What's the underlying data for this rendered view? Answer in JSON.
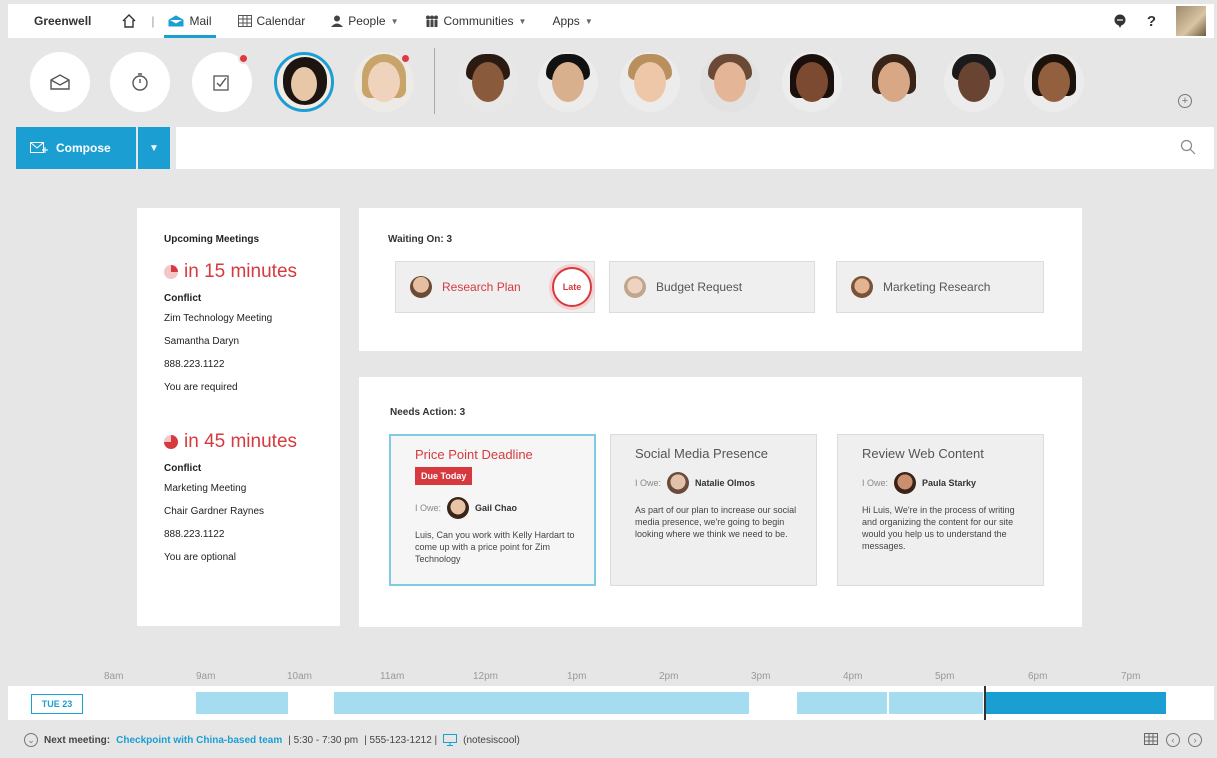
{
  "app": {
    "brand": "Greenwell"
  },
  "nav": {
    "mail": "Mail",
    "calendar": "Calendar",
    "people": "People",
    "communities": "Communities",
    "apps": "Apps"
  },
  "compose": {
    "label": "Compose"
  },
  "meetings": {
    "title": "Upcoming Meetings",
    "items": [
      {
        "when": "in 15 minutes",
        "conflict": "Conflict",
        "name": "Zim Technology Meeting",
        "chair": "Samantha Daryn",
        "phone": "888.223.1122",
        "req": "You are required"
      },
      {
        "when": "in 45 minutes",
        "conflict": "Conflict",
        "name": "Marketing Meeting",
        "chair": "Chair Gardner Raynes",
        "phone": "888.223.1122",
        "req": "You are optional"
      }
    ]
  },
  "waiting": {
    "title": "Waiting On: 3",
    "items": [
      "Research Plan",
      "Budget Request",
      "Marketing Research"
    ],
    "late": "Late"
  },
  "needs": {
    "title": "Needs Action:  3",
    "owe_label": "I Owe:",
    "due": "Due Today",
    "items": [
      {
        "title": "Price Point Deadline",
        "person": "Gail Chao",
        "body": "Luis, Can you work with Kelly Hardart to come up with a price point for Zim Technology"
      },
      {
        "title": "Social Media Presence",
        "person": "Natalie Olmos",
        "body": "As part of our plan to increase our social media presence, we're going to begin looking where we think we need to be."
      },
      {
        "title": "Review Web Content",
        "person": "Paula Starky",
        "body": "Hi Luis, We're in the process of writing and organizing the content for our site would you help us to understand the messages."
      }
    ]
  },
  "timeline": {
    "day": "TUE 23",
    "hours": [
      "8am",
      "9am",
      "10am",
      "11am",
      "12pm",
      "1pm",
      "2pm",
      "3pm",
      "4pm",
      "5pm",
      "6pm",
      "7pm"
    ]
  },
  "footer": {
    "label": "Next meeting:",
    "link": "Checkpoint with China-based team",
    "time": "| 5:30 - 7:30 pm",
    "phone": "| 555-123-1212 |",
    "code": "(notesiscool)"
  },
  "colors": {
    "accent": "#1b9fd3",
    "alert": "#d63a3f"
  }
}
